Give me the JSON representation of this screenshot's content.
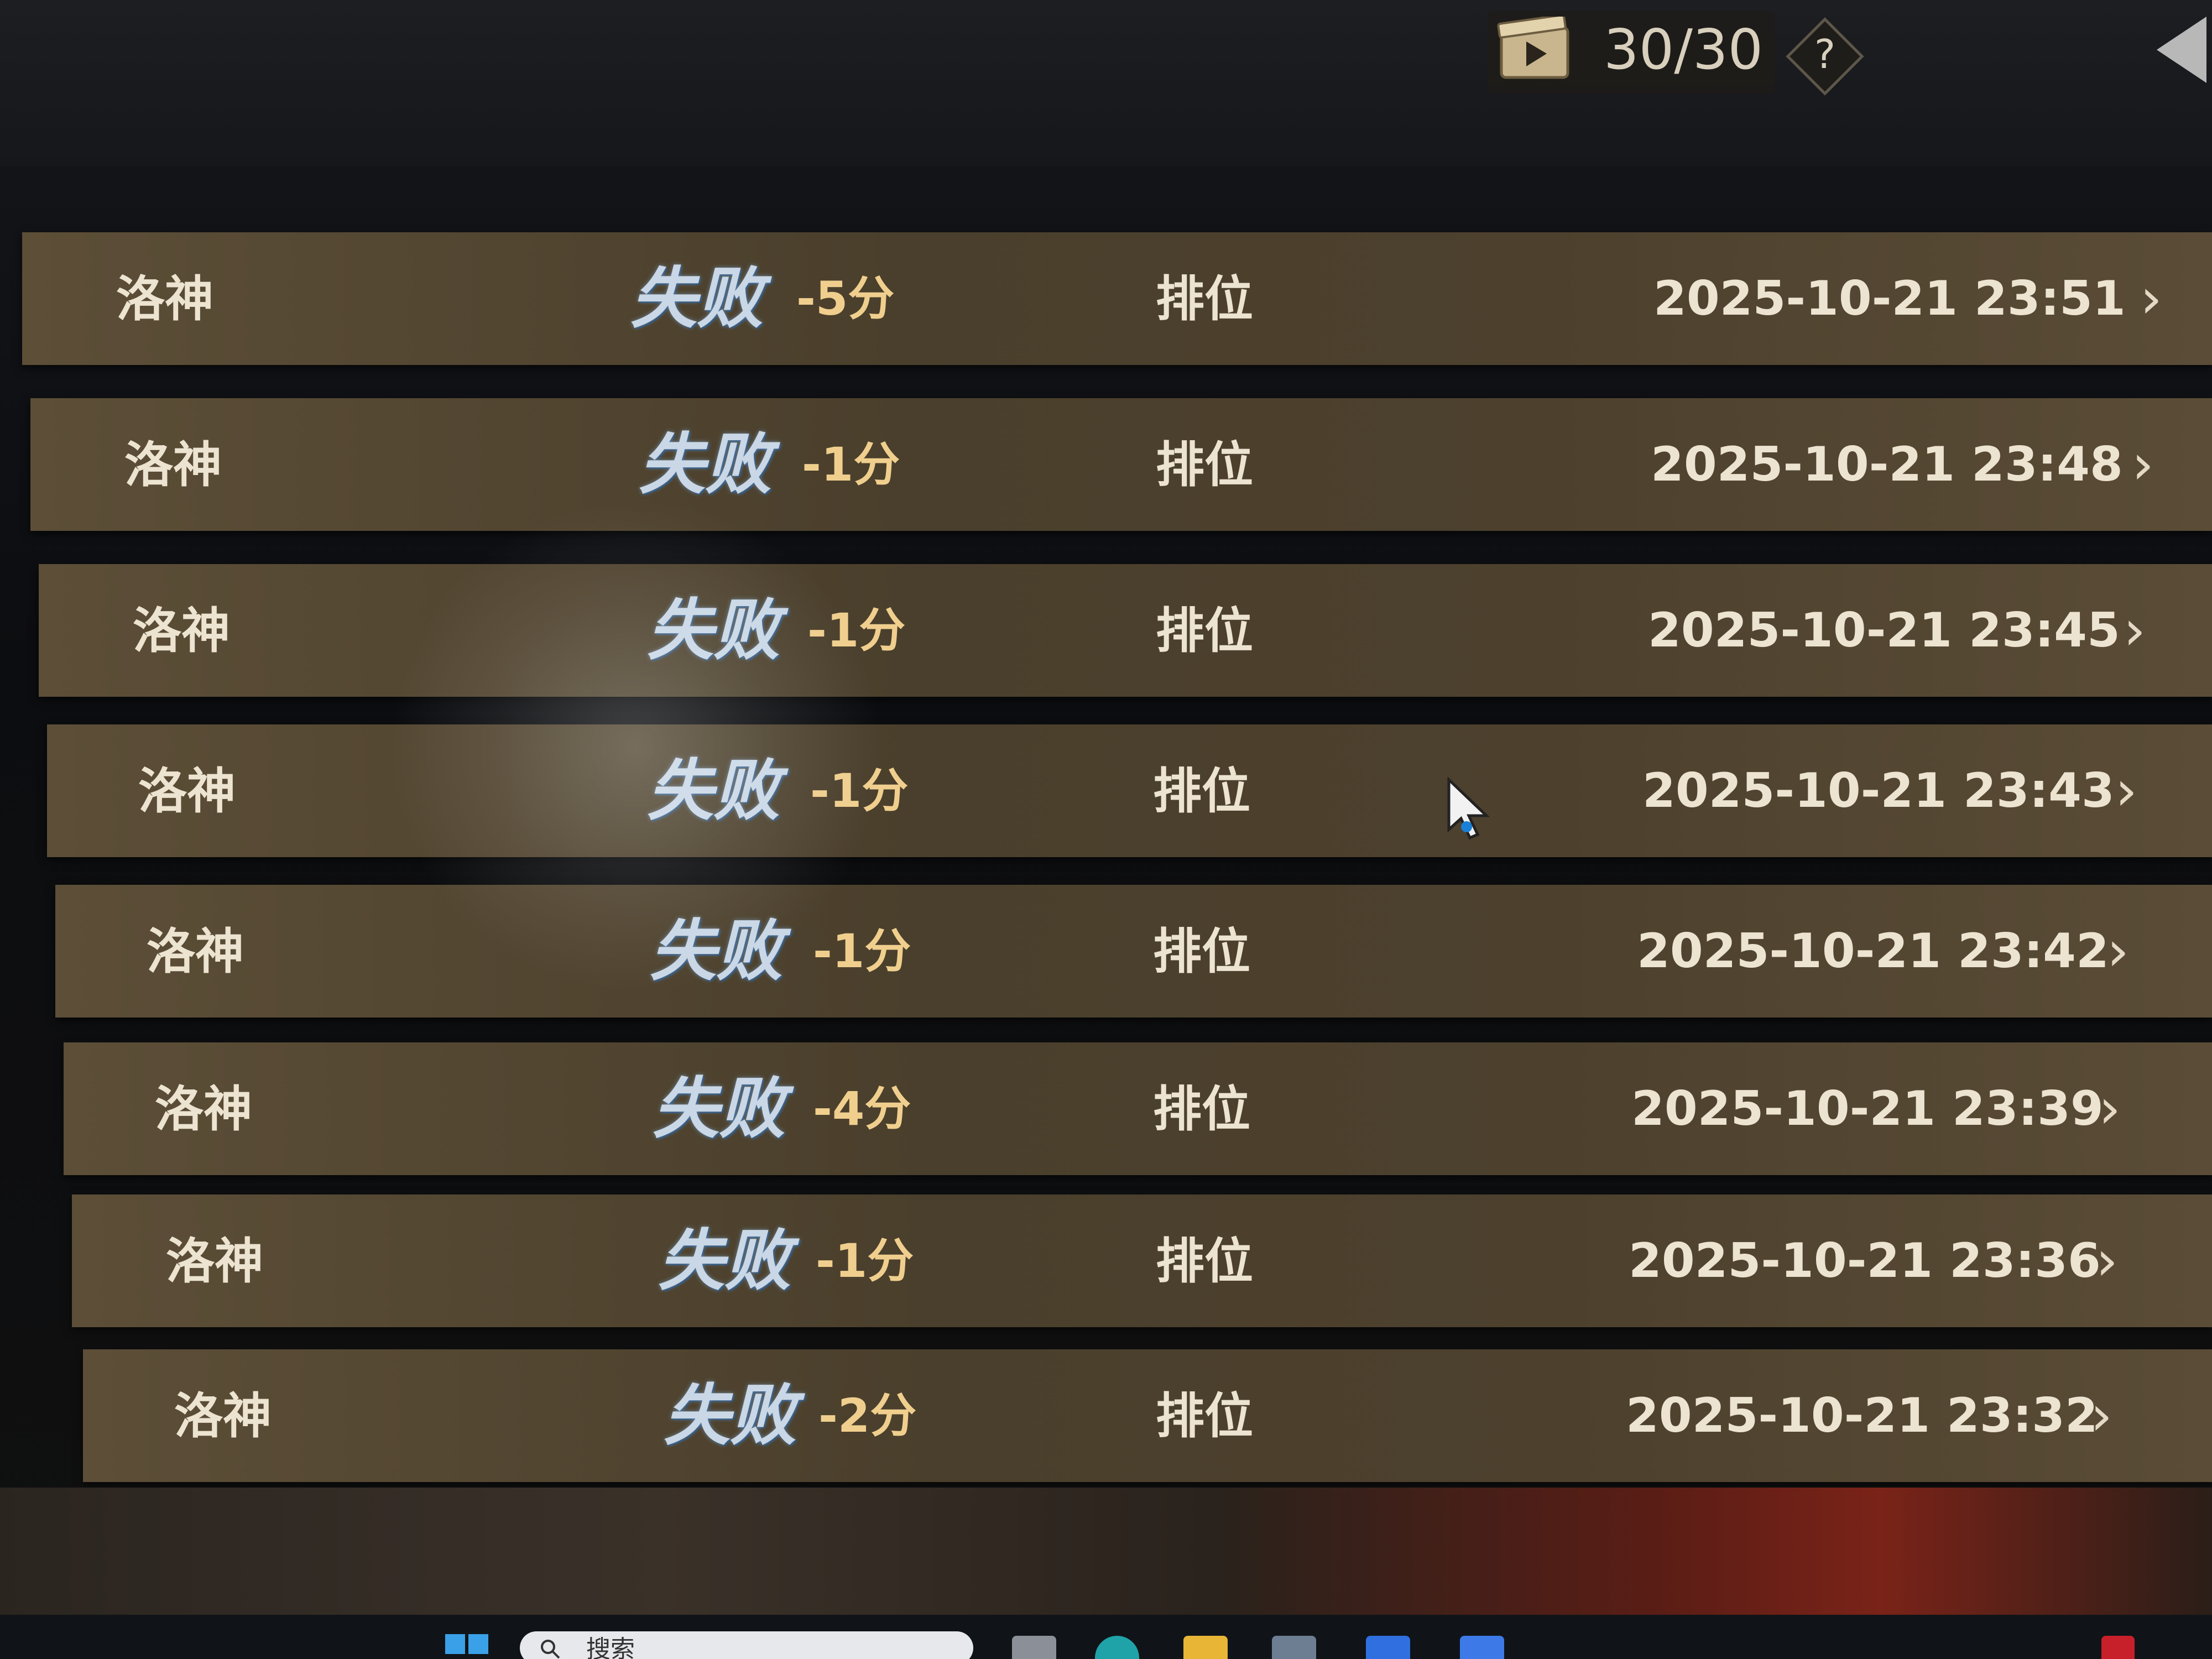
{
  "header": {
    "replay_count": "30/30",
    "help_label": "?"
  },
  "records": [
    {
      "hero": "洛神",
      "result": "失败",
      "score": "-5分",
      "mode": "排位",
      "time": "2025-10-21 23:51"
    },
    {
      "hero": "洛神",
      "result": "失败",
      "score": "-1分",
      "mode": "排位",
      "time": "2025-10-21 23:48"
    },
    {
      "hero": "洛神",
      "result": "失败",
      "score": "-1分",
      "mode": "排位",
      "time": "2025-10-21 23:45"
    },
    {
      "hero": "洛神",
      "result": "失败",
      "score": "-1分",
      "mode": "排位",
      "time": "2025-10-21 23:43"
    },
    {
      "hero": "洛神",
      "result": "失败",
      "score": "-1分",
      "mode": "排位",
      "time": "2025-10-21 23:42"
    },
    {
      "hero": "洛神",
      "result": "失败",
      "score": "-4分",
      "mode": "排位",
      "time": "2025-10-21 23:39"
    },
    {
      "hero": "洛神",
      "result": "失败",
      "score": "-1分",
      "mode": "排位",
      "time": "2025-10-21 23:36"
    },
    {
      "hero": "洛神",
      "result": "失败",
      "score": "-2分",
      "mode": "排位",
      "time": "2025-10-21 23:32"
    }
  ],
  "row_chevron": "›",
  "taskbar": {
    "search_text": "搜索"
  },
  "colors": {
    "row_bg": "#4d412e",
    "result_text": "#c9d7e6",
    "score_text": "#f0cf8e",
    "primary_text": "#ece3d0"
  }
}
